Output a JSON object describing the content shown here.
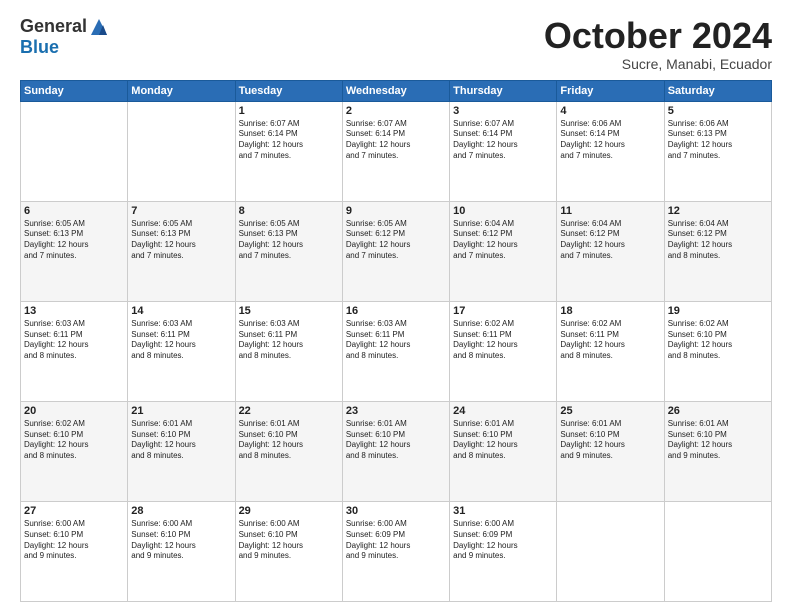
{
  "logo": {
    "general": "General",
    "blue": "Blue"
  },
  "title": "October 2024",
  "subtitle": "Sucre, Manabi, Ecuador",
  "days": [
    "Sunday",
    "Monday",
    "Tuesday",
    "Wednesday",
    "Thursday",
    "Friday",
    "Saturday"
  ],
  "weeks": [
    [
      {
        "day": "",
        "info": ""
      },
      {
        "day": "",
        "info": ""
      },
      {
        "day": "1",
        "info": "Sunrise: 6:07 AM\nSunset: 6:14 PM\nDaylight: 12 hours\nand 7 minutes."
      },
      {
        "day": "2",
        "info": "Sunrise: 6:07 AM\nSunset: 6:14 PM\nDaylight: 12 hours\nand 7 minutes."
      },
      {
        "day": "3",
        "info": "Sunrise: 6:07 AM\nSunset: 6:14 PM\nDaylight: 12 hours\nand 7 minutes."
      },
      {
        "day": "4",
        "info": "Sunrise: 6:06 AM\nSunset: 6:14 PM\nDaylight: 12 hours\nand 7 minutes."
      },
      {
        "day": "5",
        "info": "Sunrise: 6:06 AM\nSunset: 6:13 PM\nDaylight: 12 hours\nand 7 minutes."
      }
    ],
    [
      {
        "day": "6",
        "info": "Sunrise: 6:05 AM\nSunset: 6:13 PM\nDaylight: 12 hours\nand 7 minutes."
      },
      {
        "day": "7",
        "info": "Sunrise: 6:05 AM\nSunset: 6:13 PM\nDaylight: 12 hours\nand 7 minutes."
      },
      {
        "day": "8",
        "info": "Sunrise: 6:05 AM\nSunset: 6:13 PM\nDaylight: 12 hours\nand 7 minutes."
      },
      {
        "day": "9",
        "info": "Sunrise: 6:05 AM\nSunset: 6:12 PM\nDaylight: 12 hours\nand 7 minutes."
      },
      {
        "day": "10",
        "info": "Sunrise: 6:04 AM\nSunset: 6:12 PM\nDaylight: 12 hours\nand 7 minutes."
      },
      {
        "day": "11",
        "info": "Sunrise: 6:04 AM\nSunset: 6:12 PM\nDaylight: 12 hours\nand 7 minutes."
      },
      {
        "day": "12",
        "info": "Sunrise: 6:04 AM\nSunset: 6:12 PM\nDaylight: 12 hours\nand 8 minutes."
      }
    ],
    [
      {
        "day": "13",
        "info": "Sunrise: 6:03 AM\nSunset: 6:11 PM\nDaylight: 12 hours\nand 8 minutes."
      },
      {
        "day": "14",
        "info": "Sunrise: 6:03 AM\nSunset: 6:11 PM\nDaylight: 12 hours\nand 8 minutes."
      },
      {
        "day": "15",
        "info": "Sunrise: 6:03 AM\nSunset: 6:11 PM\nDaylight: 12 hours\nand 8 minutes."
      },
      {
        "day": "16",
        "info": "Sunrise: 6:03 AM\nSunset: 6:11 PM\nDaylight: 12 hours\nand 8 minutes."
      },
      {
        "day": "17",
        "info": "Sunrise: 6:02 AM\nSunset: 6:11 PM\nDaylight: 12 hours\nand 8 minutes."
      },
      {
        "day": "18",
        "info": "Sunrise: 6:02 AM\nSunset: 6:11 PM\nDaylight: 12 hours\nand 8 minutes."
      },
      {
        "day": "19",
        "info": "Sunrise: 6:02 AM\nSunset: 6:10 PM\nDaylight: 12 hours\nand 8 minutes."
      }
    ],
    [
      {
        "day": "20",
        "info": "Sunrise: 6:02 AM\nSunset: 6:10 PM\nDaylight: 12 hours\nand 8 minutes."
      },
      {
        "day": "21",
        "info": "Sunrise: 6:01 AM\nSunset: 6:10 PM\nDaylight: 12 hours\nand 8 minutes."
      },
      {
        "day": "22",
        "info": "Sunrise: 6:01 AM\nSunset: 6:10 PM\nDaylight: 12 hours\nand 8 minutes."
      },
      {
        "day": "23",
        "info": "Sunrise: 6:01 AM\nSunset: 6:10 PM\nDaylight: 12 hours\nand 8 minutes."
      },
      {
        "day": "24",
        "info": "Sunrise: 6:01 AM\nSunset: 6:10 PM\nDaylight: 12 hours\nand 8 minutes."
      },
      {
        "day": "25",
        "info": "Sunrise: 6:01 AM\nSunset: 6:10 PM\nDaylight: 12 hours\nand 9 minutes."
      },
      {
        "day": "26",
        "info": "Sunrise: 6:01 AM\nSunset: 6:10 PM\nDaylight: 12 hours\nand 9 minutes."
      }
    ],
    [
      {
        "day": "27",
        "info": "Sunrise: 6:00 AM\nSunset: 6:10 PM\nDaylight: 12 hours\nand 9 minutes."
      },
      {
        "day": "28",
        "info": "Sunrise: 6:00 AM\nSunset: 6:10 PM\nDaylight: 12 hours\nand 9 minutes."
      },
      {
        "day": "29",
        "info": "Sunrise: 6:00 AM\nSunset: 6:10 PM\nDaylight: 12 hours\nand 9 minutes."
      },
      {
        "day": "30",
        "info": "Sunrise: 6:00 AM\nSunset: 6:09 PM\nDaylight: 12 hours\nand 9 minutes."
      },
      {
        "day": "31",
        "info": "Sunrise: 6:00 AM\nSunset: 6:09 PM\nDaylight: 12 hours\nand 9 minutes."
      },
      {
        "day": "",
        "info": ""
      },
      {
        "day": "",
        "info": ""
      }
    ]
  ]
}
